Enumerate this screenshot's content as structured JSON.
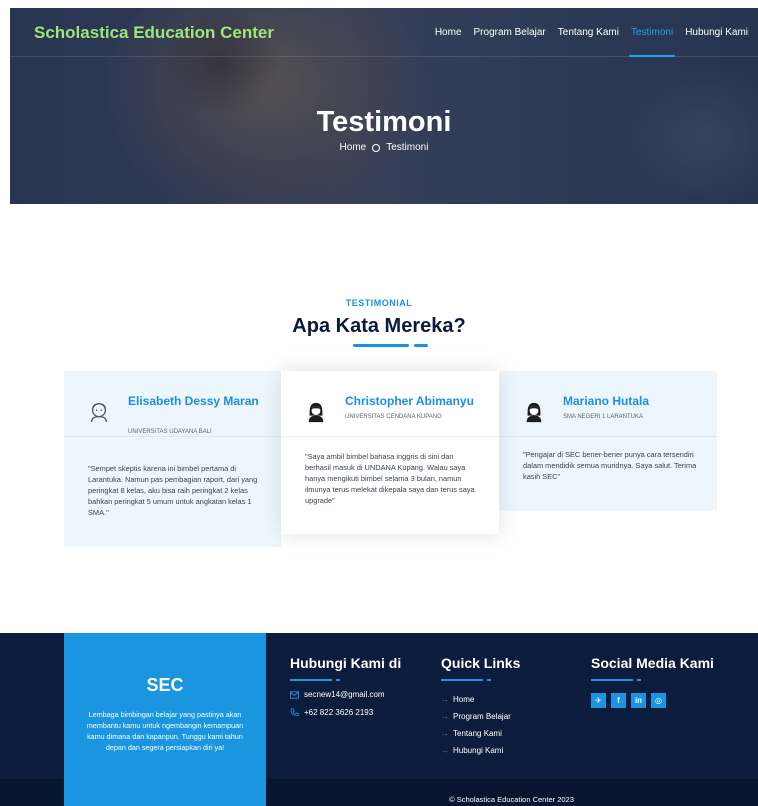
{
  "header": {
    "brand": "Scholastica Education Center",
    "nav": [
      {
        "label": "Home",
        "active": false
      },
      {
        "label": "Program Belajar",
        "active": false
      },
      {
        "label": "Tentang Kami",
        "active": false
      },
      {
        "label": "Testimoni",
        "active": true
      },
      {
        "label": "Hubungi Kami",
        "active": false
      }
    ]
  },
  "hero": {
    "title": "Testimoni",
    "breadcrumb": [
      "Home",
      "Testimoni"
    ]
  },
  "section": {
    "subtitle": "TESTIMONIAL",
    "title": "Apa Kata Mereka?"
  },
  "testimonials": [
    {
      "name": "Elisabeth Dessy Maran",
      "school": "UNIVERSITAS UDAYANA BALI",
      "quote": "\"Sempet skeptis karena ini bimbel pertama di Larantuka. Namun pas pembagian raport, dari yang peringkat 8 kelas, aku bisa raih peringkat 2 kelas bahkan peringkat 5 umum untuk angkatan kelas 1 SMA.\"",
      "avatar": "female-outline-avatar-icon"
    },
    {
      "name": "Christopher Abimanyu",
      "school": "UNIVERSITAS CENDANA KUPANG",
      "quote": "\"Saya ambil bimbel bahasa inggris di sini dan berhasil masuk di UNDANA Kupang. Walau saya hanya mengikuti bimbel selama 3 bulan, namun ilmunya terus melekat dikepala saya dan terus saya upgrade\"",
      "avatar": "female-solid-avatar-icon"
    },
    {
      "name": "Mariano Hutala",
      "school": "SMA NEGERI 1 LARANTUKA",
      "quote": "\"Pengajar di SEC bener-bener punya cara tersendiri dalam mendidik semua muridnya. Saya salut. Terima kasih SEC\"",
      "avatar": "female-solid-avatar-icon"
    }
  ],
  "footer": {
    "about_title": "SEC",
    "about_text": "Lembaga bimbingan belajar yang pastinya akan membantu kamu untuk ngembangin kemampuan kamu dimana dan kapanpun. Tunggu kami tahun depan dan segera persiapkan diri ya!",
    "contact_title": "Hubungi Kami di",
    "email": "secnew14@gmail.com",
    "phone": "+62 822 3626 2193",
    "quicklinks_title": "Quick Links",
    "quicklinks": [
      "Home",
      "Program Belajar",
      "Tentang Kami",
      "Hubungi Kami"
    ],
    "social_title": "Social Media Kami",
    "socials": [
      {
        "icon": "twitter-icon",
        "glyph": "✈"
      },
      {
        "icon": "facebook-icon",
        "glyph": "f"
      },
      {
        "icon": "linkedin-icon",
        "glyph": "in"
      },
      {
        "icon": "instagram-icon",
        "glyph": "◎"
      }
    ],
    "copyright": "© Scholastica Education Center 2023"
  },
  "colors": {
    "brand": "#9ee67a",
    "accent": "#1a8fe3",
    "footer_bg": "#0c1c3c",
    "about_bg": "#1a96e0"
  }
}
